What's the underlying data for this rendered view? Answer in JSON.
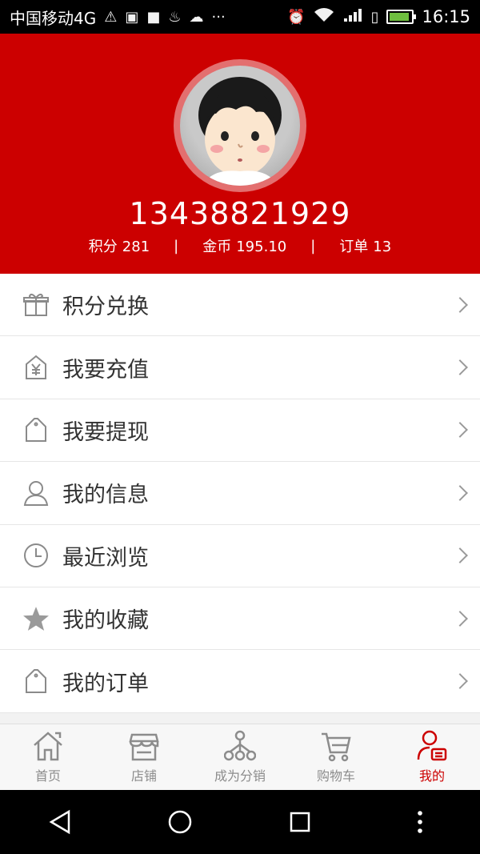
{
  "status_bar": {
    "carrier": "中国移动4G",
    "network": "4G",
    "time": "16:15"
  },
  "profile": {
    "phone": "13438821929",
    "points_label": "积分",
    "points_value": "281",
    "coins_label": "金币",
    "coins_value": "195.10",
    "orders_label": "订单",
    "orders_value": "13",
    "separator": "|"
  },
  "menu": {
    "items": [
      {
        "label": "积分兑换",
        "icon": "gift-icon"
      },
      {
        "label": "我要充值",
        "icon": "yen-tag-icon"
      },
      {
        "label": "我要提现",
        "icon": "tag-icon"
      },
      {
        "label": "我的信息",
        "icon": "user-icon"
      },
      {
        "label": "最近浏览",
        "icon": "clock-icon"
      },
      {
        "label": "我的收藏",
        "icon": "star-icon"
      },
      {
        "label": "我的订单",
        "icon": "tag-icon"
      }
    ]
  },
  "tabbar": {
    "tabs": [
      {
        "label": "首页",
        "icon": "home-icon"
      },
      {
        "label": "店铺",
        "icon": "store-icon"
      },
      {
        "label": "成为分销",
        "icon": "network-icon"
      },
      {
        "label": "购物车",
        "icon": "cart-icon"
      },
      {
        "label": "我的",
        "icon": "profile-icon",
        "active": true
      }
    ]
  },
  "colors": {
    "brand_red": "#cc0000",
    "tab_inactive": "#8c8c8c"
  }
}
